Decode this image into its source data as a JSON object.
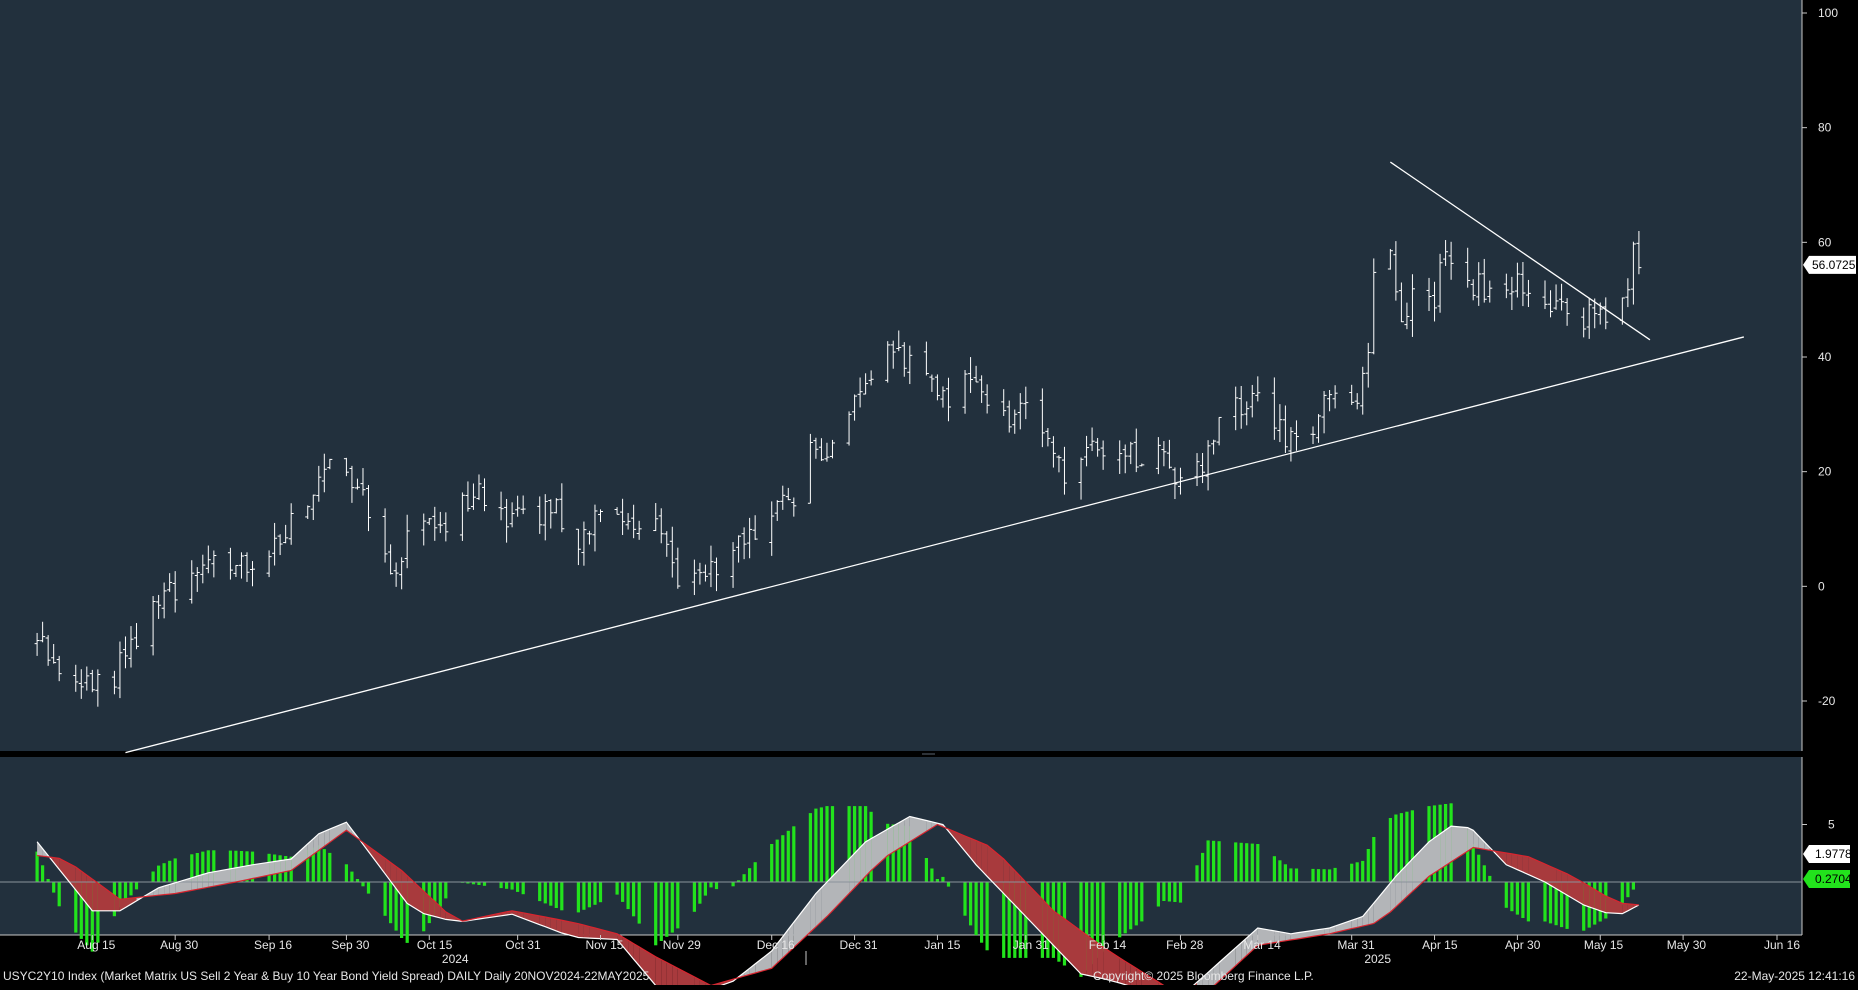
{
  "colors": {
    "panel_bg": "#22303d",
    "price_bars": "#ffffff",
    "macd_line": "#ffffff",
    "signal_line": "#d9252f",
    "fill_above": "#b3b5b8",
    "fill_below": "#a83a3d",
    "histogram": "#22e31c",
    "current_value_tag": "#ffffff",
    "hist_value_tag": "#22e31c"
  },
  "chart_data": {
    "type": "ohlc",
    "title": "USYC2Y10 Index (Market Matrix US Sell 2 Year & Buy 10 Year Bond Yield Spread) DAILY  Daily 20NOV2024-22MAY2025",
    "copyright": "Copyright© 2025 Bloomberg Finance L.P.",
    "timestamp": "22-May-2025 12:41:16",
    "x_tick_labels": [
      "Aug 15",
      "Aug 30",
      "Sep 16",
      "Sep 30",
      "Oct 15",
      "Oct 31",
      "Nov 15",
      "Nov 29",
      "Dec 16",
      "Dec 31",
      "Jan 15",
      "Jan 31",
      "Feb 14",
      "Feb 28",
      "Mar 14",
      "Mar 31",
      "Apr 15",
      "Apr 30",
      "May 15",
      "May 30",
      "Jun 16"
    ],
    "year_labels": [
      {
        "label": "2024",
        "after_tick": "Oct 15"
      },
      {
        "label": "2025",
        "after_tick": "Mar 31"
      }
    ],
    "price_axis": {
      "ylim": [
        -28,
        102
      ],
      "ticks": [
        100,
        80,
        60,
        40,
        20,
        0,
        -20
      ],
      "grid": false,
      "position": "right"
    },
    "current_price_label": "56.0725",
    "price_waypoints": [
      {
        "x": "2024-08-05",
        "y": -10
      },
      {
        "x": "2024-08-09",
        "y": -14
      },
      {
        "x": "2024-08-13",
        "y": -17
      },
      {
        "x": "2024-08-19",
        "y": -16
      },
      {
        "x": "2024-08-22",
        "y": -10
      },
      {
        "x": "2024-08-28",
        "y": -2
      },
      {
        "x": "2024-09-03",
        "y": 2
      },
      {
        "x": "2024-09-06",
        "y": 5
      },
      {
        "x": "2024-09-12",
        "y": 4
      },
      {
        "x": "2024-09-18",
        "y": 8
      },
      {
        "x": "2024-09-24",
        "y": 18
      },
      {
        "x": "2024-09-27",
        "y": 22
      },
      {
        "x": "2024-10-01",
        "y": 18
      },
      {
        "x": "2024-10-04",
        "y": 13
      },
      {
        "x": "2024-10-08",
        "y": 3
      },
      {
        "x": "2024-10-11",
        "y": 8
      },
      {
        "x": "2024-10-17",
        "y": 10
      },
      {
        "x": "2024-10-23",
        "y": 17
      },
      {
        "x": "2024-10-28",
        "y": 13
      },
      {
        "x": "2024-11-01",
        "y": 12
      },
      {
        "x": "2024-11-07",
        "y": 14
      },
      {
        "x": "2024-11-11",
        "y": 7
      },
      {
        "x": "2024-11-15",
        "y": 12
      },
      {
        "x": "2024-11-20",
        "y": 13
      },
      {
        "x": "2024-11-25",
        "y": 10
      },
      {
        "x": "2024-11-29",
        "y": 2
      },
      {
        "x": "2024-12-03",
        "y": 0
      },
      {
        "x": "2024-12-06",
        "y": 4
      },
      {
        "x": "2024-12-11",
        "y": 8
      },
      {
        "x": "2024-12-16",
        "y": 12
      },
      {
        "x": "2024-12-20",
        "y": 15
      },
      {
        "x": "2024-12-23",
        "y": 24
      },
      {
        "x": "2024-12-27",
        "y": 25
      },
      {
        "x": "2024-12-31",
        "y": 33
      },
      {
        "x": "2025-01-03",
        "y": 35
      },
      {
        "x": "2025-01-06",
        "y": 40
      },
      {
        "x": "2025-01-10",
        "y": 40
      },
      {
        "x": "2025-01-14",
        "y": 35
      },
      {
        "x": "2025-01-17",
        "y": 31
      },
      {
        "x": "2025-01-21",
        "y": 36
      },
      {
        "x": "2025-01-24",
        "y": 34
      },
      {
        "x": "2025-01-28",
        "y": 30
      },
      {
        "x": "2025-01-31",
        "y": 31
      },
      {
        "x": "2025-02-04",
        "y": 24
      },
      {
        "x": "2025-02-07",
        "y": 20
      },
      {
        "x": "2025-02-11",
        "y": 22
      },
      {
        "x": "2025-02-14",
        "y": 25
      },
      {
        "x": "2025-02-19",
        "y": 23
      },
      {
        "x": "2025-02-24",
        "y": 24
      },
      {
        "x": "2025-02-28",
        "y": 19
      },
      {
        "x": "2025-03-04",
        "y": 22
      },
      {
        "x": "2025-03-07",
        "y": 30
      },
      {
        "x": "2025-03-11",
        "y": 32
      },
      {
        "x": "2025-03-14",
        "y": 32
      },
      {
        "x": "2025-03-18",
        "y": 27
      },
      {
        "x": "2025-03-21",
        "y": 24
      },
      {
        "x": "2025-03-25",
        "y": 30
      },
      {
        "x": "2025-03-28",
        "y": 33
      },
      {
        "x": "2025-04-01",
        "y": 30
      },
      {
        "x": "2025-04-03",
        "y": 42
      },
      {
        "x": "2025-04-04",
        "y": 54
      },
      {
        "x": "2025-04-07",
        "y": 58
      },
      {
        "x": "2025-04-09",
        "y": 44
      },
      {
        "x": "2025-04-11",
        "y": 52
      },
      {
        "x": "2025-04-15",
        "y": 50
      },
      {
        "x": "2025-04-17",
        "y": 58
      },
      {
        "x": "2025-04-22",
        "y": 52
      },
      {
        "x": "2025-04-25",
        "y": 52
      },
      {
        "x": "2025-04-30",
        "y": 53
      },
      {
        "x": "2025-05-05",
        "y": 50
      },
      {
        "x": "2025-05-08",
        "y": 48
      },
      {
        "x": "2025-05-12",
        "y": 47
      },
      {
        "x": "2025-05-15",
        "y": 46
      },
      {
        "x": "2025-05-19",
        "y": 50
      },
      {
        "x": "2025-05-21",
        "y": 58
      },
      {
        "x": "2025-05-22",
        "y": 56
      }
    ],
    "trendlines": [
      {
        "name": "rising-support",
        "from": {
          "x": "2024-08-21",
          "y": -29
        },
        "to": {
          "x": "2025-06-10",
          "y": 43.5
        }
      },
      {
        "name": "falling-resistance",
        "from": {
          "x": "2025-04-07",
          "y": 74
        },
        "to": {
          "x": "2025-05-24",
          "y": 43
        }
      }
    ],
    "indicator": {
      "type": "macd",
      "ylim": [
        -8,
        9
      ],
      "ticks": [
        5
      ],
      "zero_line": true,
      "macd_label": "1.9778",
      "histogram_label": "0.2704",
      "macd_points": [
        {
          "x": "2024-08-05",
          "y": 3.5
        },
        {
          "x": "2024-08-10",
          "y": 0.5
        },
        {
          "x": "2024-08-15",
          "y": -2.5
        },
        {
          "x": "2024-08-20",
          "y": -2.5
        },
        {
          "x": "2024-08-27",
          "y": -0.5
        },
        {
          "x": "2024-09-05",
          "y": 0.8
        },
        {
          "x": "2024-09-13",
          "y": 1.5
        },
        {
          "x": "2024-09-20",
          "y": 2.0
        },
        {
          "x": "2024-09-25",
          "y": 4.2
        },
        {
          "x": "2024-09-30",
          "y": 5.2
        },
        {
          "x": "2024-10-05",
          "y": 2.0
        },
        {
          "x": "2024-10-12",
          "y": -2.5
        },
        {
          "x": "2024-10-20",
          "y": -3.5
        },
        {
          "x": "2024-10-30",
          "y": -2.8
        },
        {
          "x": "2024-11-10",
          "y": -4.8
        },
        {
          "x": "2024-11-18",
          "y": -5.0
        },
        {
          "x": "2024-11-25",
          "y": -9.0
        },
        {
          "x": "2024-12-01",
          "y": -9.5
        },
        {
          "x": "2024-12-08",
          "y": -9.0
        },
        {
          "x": "2024-12-16",
          "y": -6.0
        },
        {
          "x": "2024-12-24",
          "y": -1.0
        },
        {
          "x": "2025-01-02",
          "y": 3.5
        },
        {
          "x": "2025-01-10",
          "y": 5.7
        },
        {
          "x": "2025-01-16",
          "y": 5.0
        },
        {
          "x": "2025-01-22",
          "y": 1.5
        },
        {
          "x": "2025-02-02",
          "y": -4.0
        },
        {
          "x": "2025-02-10",
          "y": -8.0
        },
        {
          "x": "2025-02-15",
          "y": -8.5
        },
        {
          "x": "2025-02-22",
          "y": -9.5
        },
        {
          "x": "2025-02-28",
          "y": -10.0
        },
        {
          "x": "2025-03-07",
          "y": -7.0
        },
        {
          "x": "2025-03-14",
          "y": -4.0
        },
        {
          "x": "2025-03-20",
          "y": -4.5
        },
        {
          "x": "2025-03-27",
          "y": -4.0
        },
        {
          "x": "2025-04-02",
          "y": -3.0
        },
        {
          "x": "2025-04-08",
          "y": 0.5
        },
        {
          "x": "2025-04-14",
          "y": 3.5
        },
        {
          "x": "2025-04-19",
          "y": 5.2
        },
        {
          "x": "2025-04-22",
          "y": 4.5
        },
        {
          "x": "2025-04-28",
          "y": 1.5
        },
        {
          "x": "2025-05-05",
          "y": 0.0
        },
        {
          "x": "2025-05-12",
          "y": -2.0
        },
        {
          "x": "2025-05-18",
          "y": -3.0
        },
        {
          "x": "2025-05-22",
          "y": -2.0
        }
      ],
      "signal_points": [
        {
          "x": "2024-08-05",
          "y": 2.3
        },
        {
          "x": "2024-08-10",
          "y": 2.0
        },
        {
          "x": "2024-08-20",
          "y": -1.5
        },
        {
          "x": "2024-08-30",
          "y": -1.0
        },
        {
          "x": "2024-09-10",
          "y": 0.0
        },
        {
          "x": "2024-09-20",
          "y": 1.0
        },
        {
          "x": "2024-09-30",
          "y": 4.5
        },
        {
          "x": "2024-10-10",
          "y": 1.0
        },
        {
          "x": "2024-10-20",
          "y": -3.5
        },
        {
          "x": "2024-10-30",
          "y": -2.5
        },
        {
          "x": "2024-11-10",
          "y": -3.5
        },
        {
          "x": "2024-11-18",
          "y": -4.5
        },
        {
          "x": "2024-11-25",
          "y": -6.5
        },
        {
          "x": "2024-12-05",
          "y": -9.0
        },
        {
          "x": "2024-12-16",
          "y": -7.5
        },
        {
          "x": "2024-12-26",
          "y": -3.0
        },
        {
          "x": "2025-01-05",
          "y": 2.0
        },
        {
          "x": "2025-01-15",
          "y": 5.0
        },
        {
          "x": "2025-01-25",
          "y": 3.0
        },
        {
          "x": "2025-02-05",
          "y": -2.5
        },
        {
          "x": "2025-02-15",
          "y": -6.0
        },
        {
          "x": "2025-02-25",
          "y": -9.0
        },
        {
          "x": "2025-03-05",
          "y": -9.5
        },
        {
          "x": "2025-03-14",
          "y": -5.5
        },
        {
          "x": "2025-03-27",
          "y": -4.5
        },
        {
          "x": "2025-04-05",
          "y": -3.5
        },
        {
          "x": "2025-04-14",
          "y": 0.5
        },
        {
          "x": "2025-04-22",
          "y": 3.0
        },
        {
          "x": "2025-05-02",
          "y": 2.2
        },
        {
          "x": "2025-05-10",
          "y": 0.5
        },
        {
          "x": "2025-05-18",
          "y": -1.8
        },
        {
          "x": "2025-05-22",
          "y": -2.0
        }
      ]
    }
  }
}
